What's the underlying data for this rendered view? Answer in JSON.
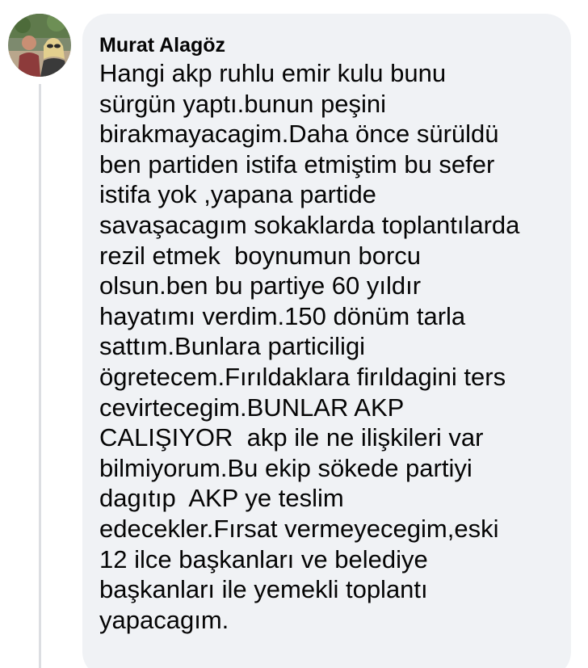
{
  "comment": {
    "author": "Murat Alagöz",
    "avatar_icon": "profile-photo-avatar",
    "lines": [
      "Hangi akp ruhlu emir kulu bunu",
      "sürgün yaptı.bunun peşini",
      "birakmayacagim.Daha önce sürüldü",
      "ben partiden istifa etmiştim bu sefer",
      "istifa yok ,yapana partide",
      "savaşacagım sokaklarda toplantılarda",
      "rezil etmek  boynumun borcu",
      "olsun.ben bu partiye 60 yıldır",
      "hayatımı verdim.150 dönüm tarla",
      "sattım.Bunlara particiligi",
      "ögretecem.Fırıldaklara firıldagini ters",
      "cevirtecegim.BUNLAR AKP",
      "CALIŞIYOR  akp ile ne ilişkileri var",
      "bilmiyorum.Bu ekip sökede partiyi",
      "dagıtıp  AKP ye teslim",
      "edecekler.Fırsat vermeyecegim,eski",
      "12 ilce başkanları ve belediye",
      "başkanları ile yemekli toplantı",
      "yapacagım."
    ]
  },
  "colors": {
    "bubble_background": "#f0f2f5",
    "text": "#050505",
    "thread_line": "#dcdee2"
  }
}
